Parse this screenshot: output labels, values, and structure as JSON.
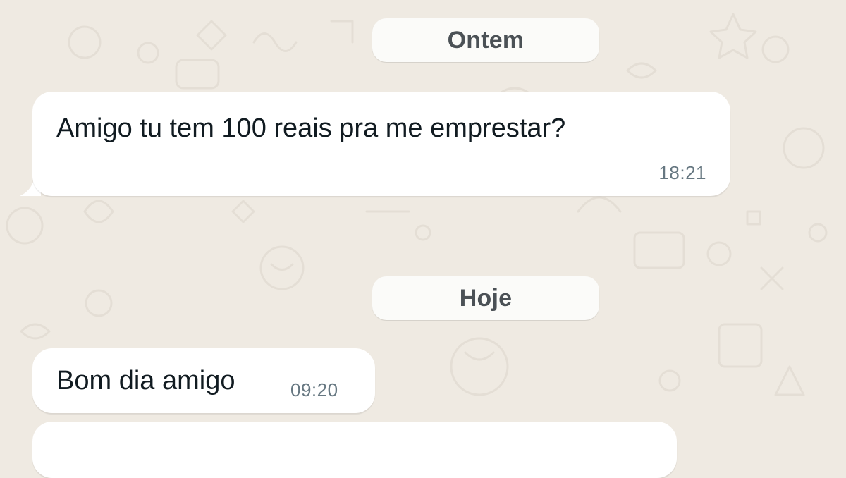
{
  "chat": {
    "background_color": "#efeae2",
    "bubble_color": "#ffffff",
    "date_separators": [
      {
        "label": "Ontem"
      },
      {
        "label": "Hoje"
      }
    ],
    "messages": [
      {
        "text": "Amigo tu tem 100 reais pra me emprestar?",
        "time": "18:21",
        "direction": "incoming"
      },
      {
        "text": "Bom dia amigo",
        "time": "09:20",
        "direction": "incoming"
      },
      {
        "text": "",
        "time": "",
        "direction": "incoming",
        "partially_visible": true
      }
    ]
  }
}
